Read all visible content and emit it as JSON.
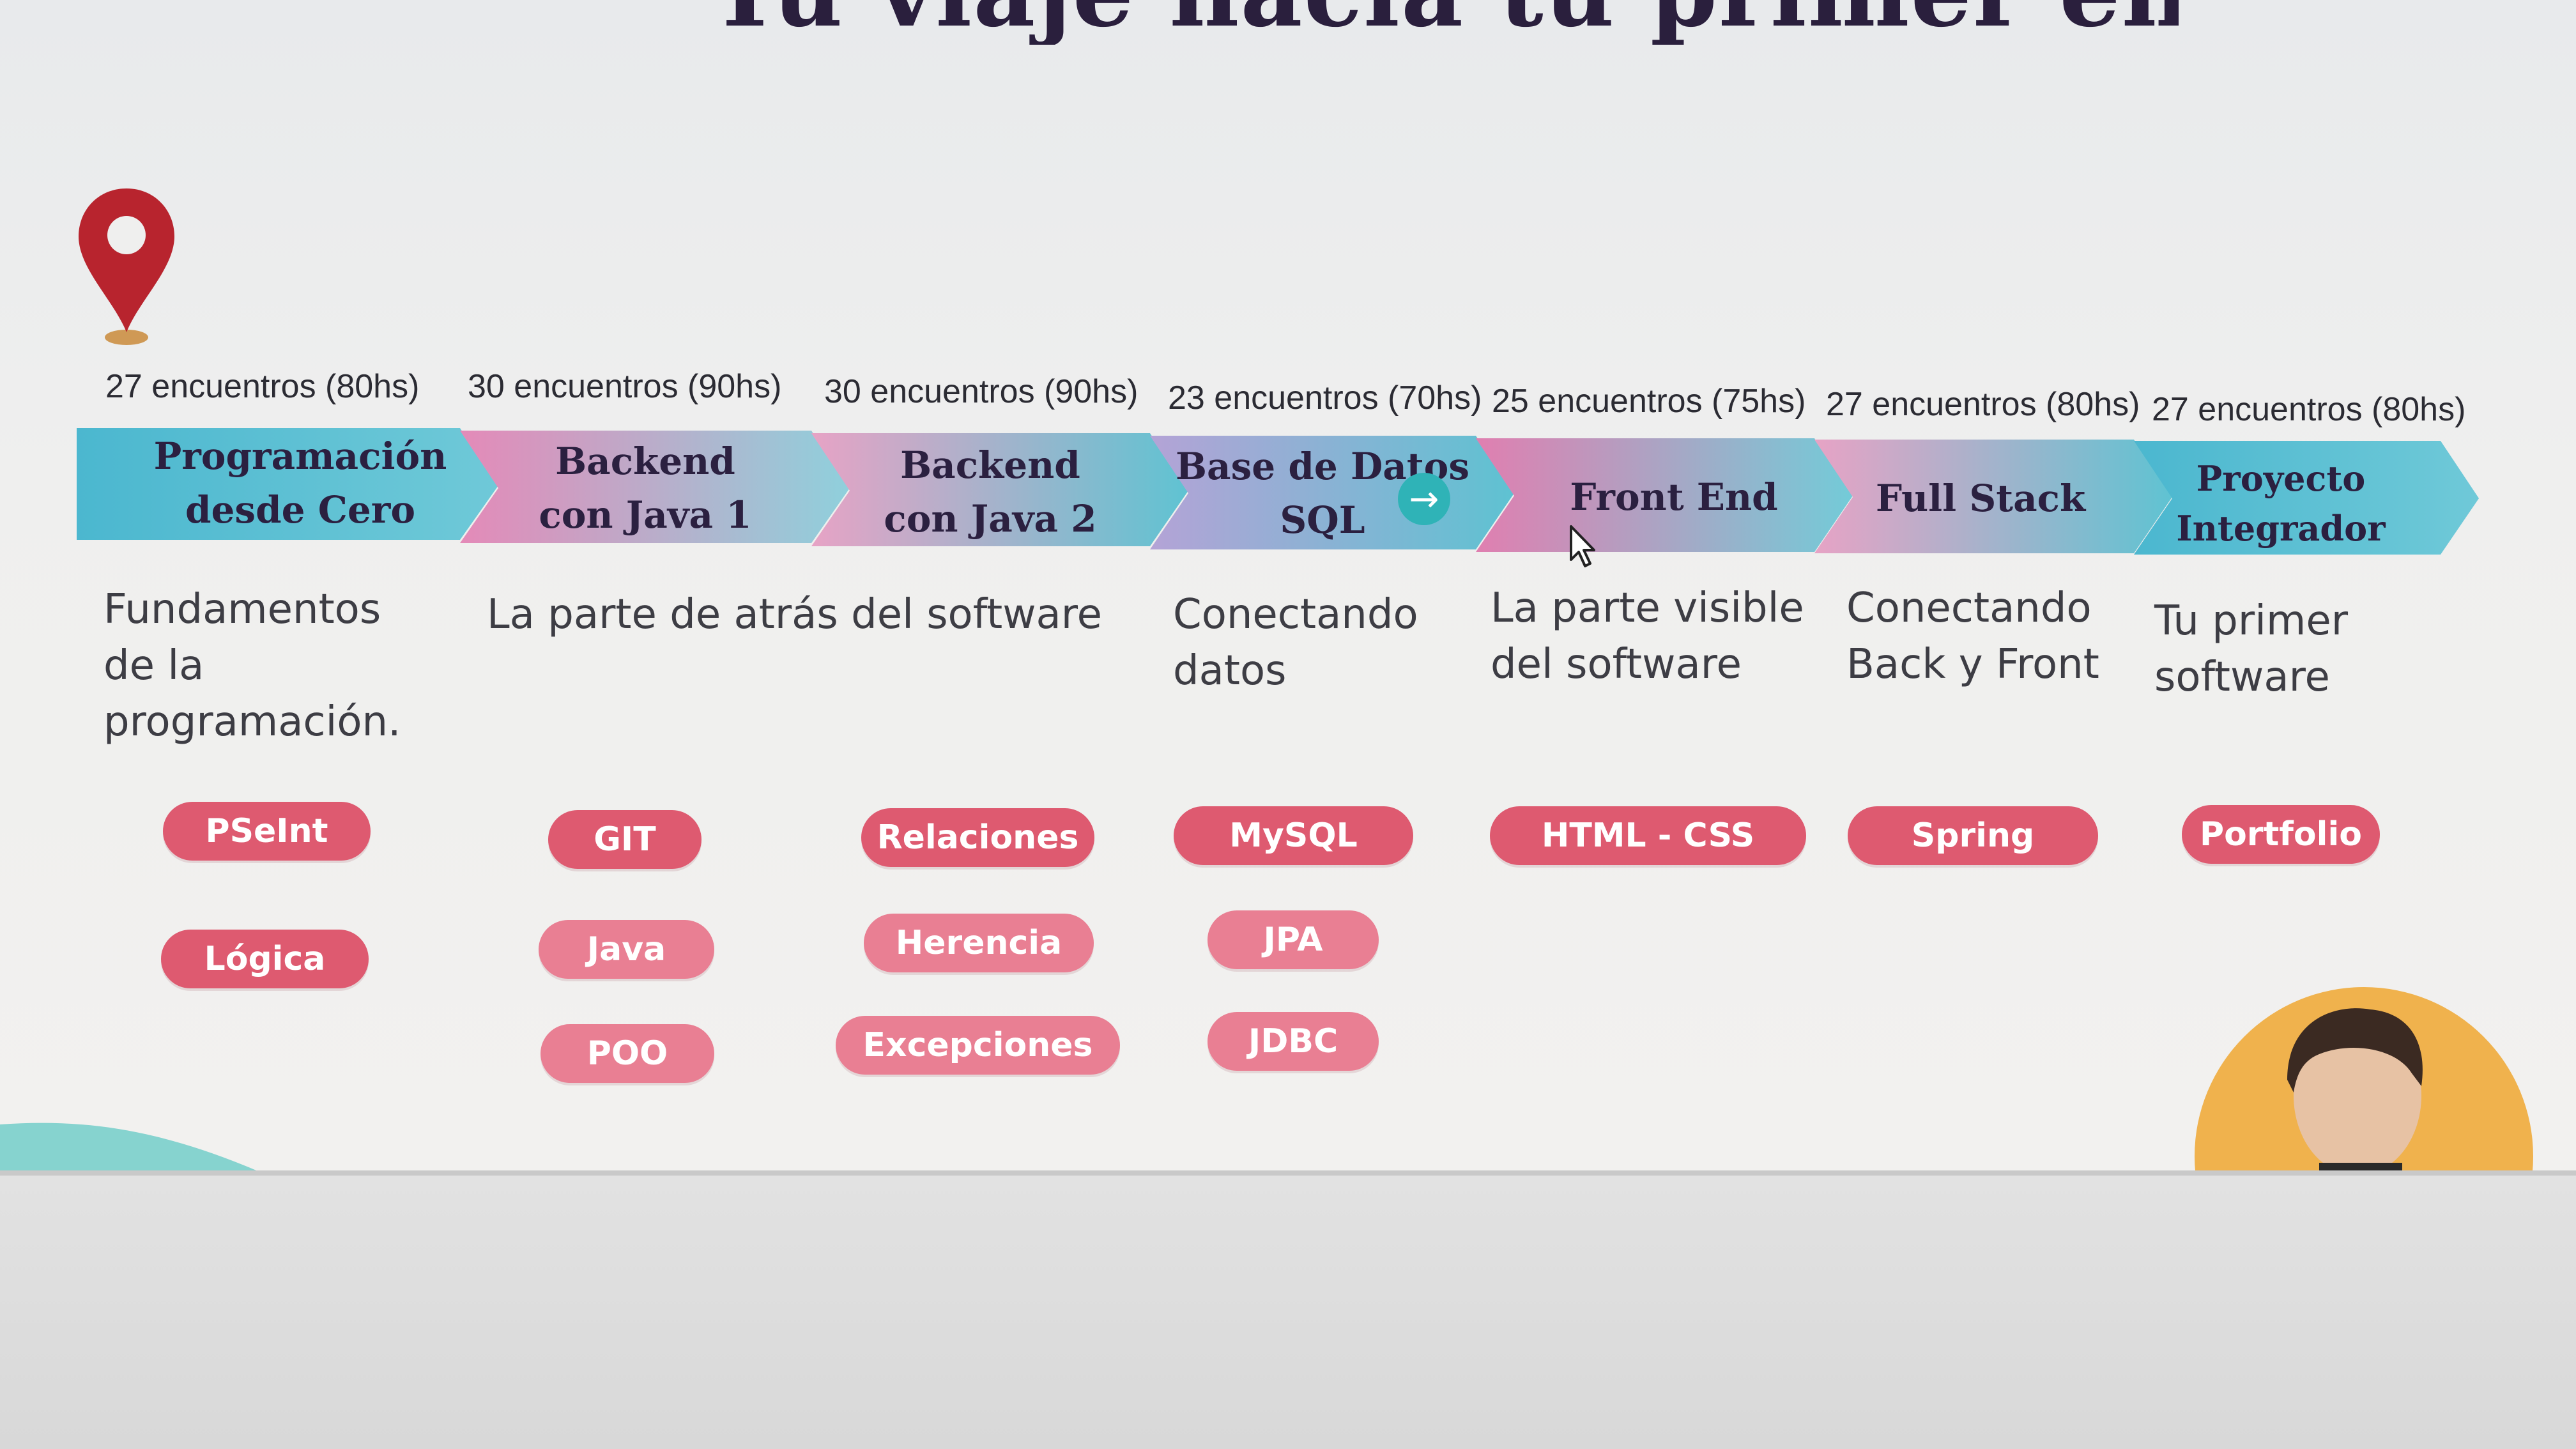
{
  "slide": {
    "title": "Tu viaje hacia tu primer empleo digital",
    "colors": {
      "ribbon_teal": "#4cc2cf",
      "ribbon_pink": "#e07fb0",
      "chip_dark": "#de5a70",
      "chip_light": "#e97f93",
      "pin_red": "#b8242e",
      "arrow_button": "#2fb3b7"
    },
    "icons": [
      "location-pin-icon",
      "arrow-right-icon",
      "mouse-cursor-icon"
    ],
    "modules": [
      {
        "hours": "27 encuentros (80hs)",
        "name_line1": "Programación",
        "name_line2": "desde Cero",
        "desc": "Fundamentos de la programación.",
        "tags": [
          "PSeInt",
          "Lógica"
        ]
      },
      {
        "hours": "30 encuentros (90hs)",
        "name_line1": "Backend",
        "name_line2": "con Java 1",
        "desc": "La parte de atrás del software",
        "tags": [
          "GIT",
          "Java",
          "POO"
        ]
      },
      {
        "hours": "30 encuentros (90hs)",
        "name_line1": "Backend",
        "name_line2": "con Java 2",
        "desc": "",
        "tags": [
          "Relaciones",
          "Herencia",
          "Excepciones"
        ]
      },
      {
        "hours": "23 encuentros (70hs)",
        "name_line1": "Base de Datos",
        "name_line2": "SQL",
        "desc": "Conectando datos",
        "tags": [
          "MySQL",
          "JPA",
          "JDBC"
        ]
      },
      {
        "hours": "25 encuentros (75hs)",
        "name_line1": "Front End",
        "name_line2": "",
        "desc": "La parte visible del software",
        "tags": [
          "HTML - CSS"
        ]
      },
      {
        "hours": "27 encuentros (80hs)",
        "name_line1": "Full Stack",
        "name_line2": "",
        "desc": "Conectando Back y Front",
        "tags": [
          "Spring"
        ]
      },
      {
        "hours": "27 encuentros (80hs)",
        "name_line1": "Proyecto",
        "name_line2": "Integrador",
        "desc": "Tu primer software",
        "tags": [
          "Portfolio"
        ]
      }
    ]
  }
}
